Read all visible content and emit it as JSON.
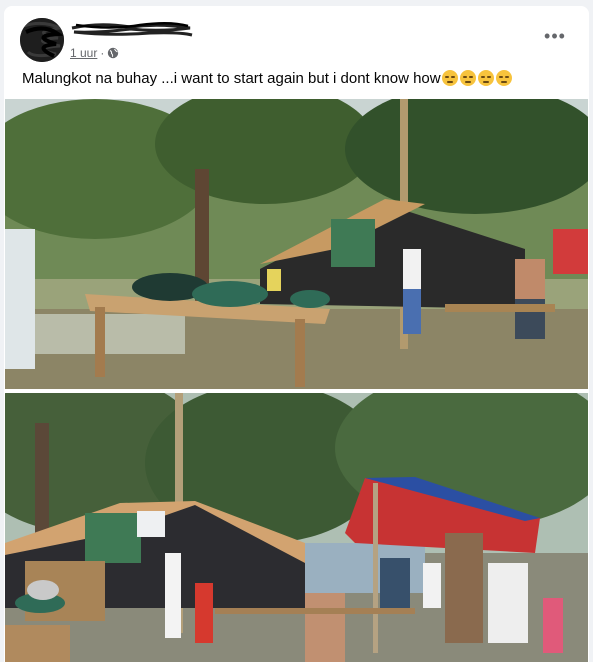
{
  "post": {
    "author_name_redacted": true,
    "timestamp": "1 uur",
    "separator": "·",
    "audience_icon": "globe-icon",
    "more_icon": "more-options-icon",
    "more_label": "•••",
    "caption": "Malungkot na buhay ...i want to start again but  i dont know how",
    "caption_emojis": [
      "pensive-face",
      "pensive-face",
      "pensive-face",
      "pensive-face"
    ],
    "photos": [
      {
        "name": "photo-campsite-tent-table"
      },
      {
        "name": "photo-campsite-tents-people"
      }
    ]
  },
  "colors": {
    "background": "#f0f2f5",
    "card": "#ffffff",
    "text": "#050505",
    "secondary_text": "#65676b"
  }
}
